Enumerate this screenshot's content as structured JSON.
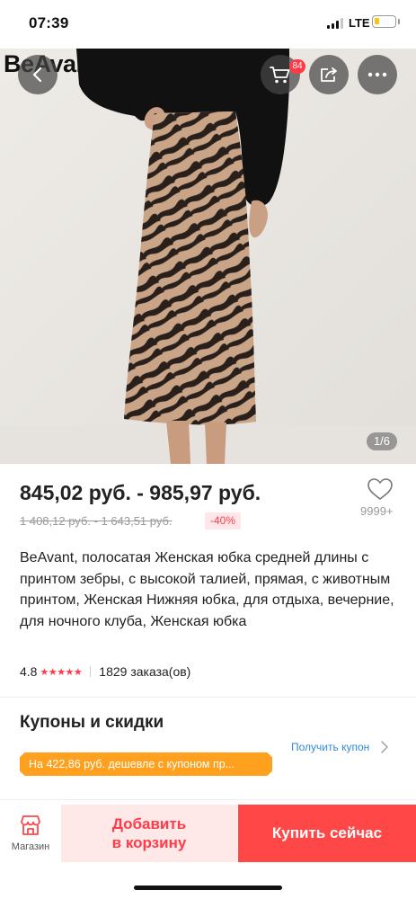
{
  "status_bar": {
    "time": "07:39",
    "network": "LTE"
  },
  "header": {
    "brand": "BeAvant",
    "cart_count": "84",
    "image_counter": "1/6"
  },
  "product": {
    "price": "845,02 руб. - 985,97 руб.",
    "old_price": "1 408,12 руб. - 1 643,51 руб.",
    "discount": "-40%",
    "wishlist_count": "9999+",
    "title": "BeAvant, полосатая Женская юбка средней длины с принтом зебры, с высокой талией, прямая, с животным принтом, Женская Нижняя юбка, для отдыха, вечерние, для ночного клуба, Женская юбка",
    "rating": "4.8",
    "rating_stars": "★★★★★",
    "orders": "1829 заказа(ов)"
  },
  "coupons": {
    "title": "Купоны и скидки",
    "get_coupon_label": "Получить купон",
    "banner_text": "На 422,86 руб. дешевле с купоном пр..."
  },
  "bottom_bar": {
    "store_label": "Магазин",
    "add_to_cart_line1": "Добавить",
    "add_to_cart_line2": "в корзину",
    "buy_now_label": "Купить сейчас"
  },
  "colors": {
    "accent": "#ff4747",
    "coupon_banner": "#ffa01e",
    "link": "#2e8bd8",
    "add_to_cart_bg": "#ffe8e8"
  },
  "icons": [
    "chevron-left-icon",
    "cart-icon",
    "share-icon",
    "more-icon",
    "heart-icon",
    "store-icon",
    "chevron-right-icon",
    "star-icon"
  ]
}
